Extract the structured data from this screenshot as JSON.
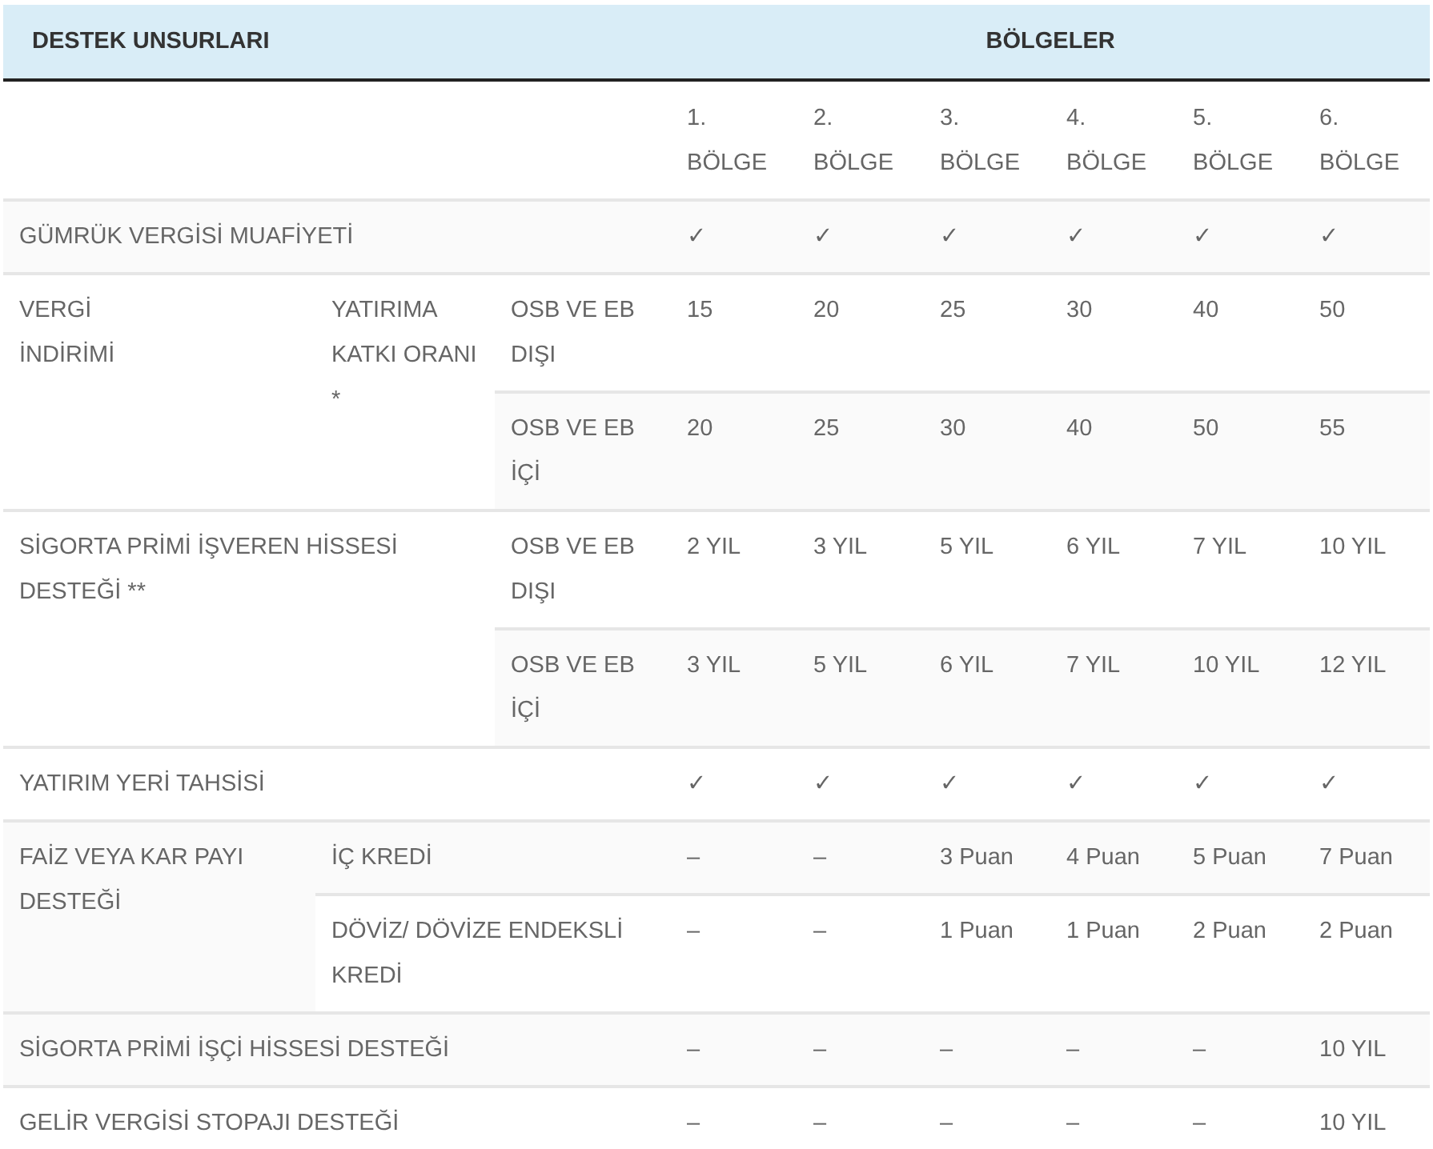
{
  "header": {
    "label": "DESTEK UNSURLARI",
    "regions_label": "BÖLGELER"
  },
  "regions": [
    "1. BÖLGE",
    "2. BÖLGE",
    "3. BÖLGE",
    "4. BÖLGE",
    "5. BÖLGE",
    "6. BÖLGE"
  ],
  "rows": [
    {
      "kind": "single",
      "label": "GÜMRÜK VERGİSİ MUAFİYETİ",
      "values": [
        "✓",
        "✓",
        "✓",
        "✓",
        "✓",
        "✓"
      ]
    },
    {
      "kind": "nested",
      "label": "VERGİ İNDİRİMİ",
      "children": [
        {
          "label": "YATIRIMA KATKI ORANI *",
          "children": [
            {
              "label": "OSB VE EB DIŞI",
              "values": [
                "15",
                "20",
                "25",
                "30",
                "40",
                "50"
              ]
            },
            {
              "label": "OSB VE EB İÇİ",
              "values": [
                "20",
                "25",
                "30",
                "40",
                "50",
                "55"
              ]
            }
          ]
        }
      ]
    },
    {
      "kind": "wide_group",
      "label": "SİGORTA PRİMİ İŞVEREN HİSSESİ DESTEĞİ **",
      "children": [
        {
          "label": "OSB VE EB DIŞI",
          "values": [
            "2 YIL",
            "3 YIL",
            "5 YIL",
            "6 YIL",
            "7 YIL",
            "10 YIL"
          ]
        },
        {
          "label": "OSB VE EB İÇİ",
          "values": [
            "3 YIL",
            "5 YIL",
            "6 YIL",
            "7 YIL",
            "10 YIL",
            "12 YIL"
          ]
        }
      ]
    },
    {
      "kind": "single",
      "label": "YATIRIM YERİ TAHSİSİ",
      "values": [
        "✓",
        "✓",
        "✓",
        "✓",
        "✓",
        "✓"
      ]
    },
    {
      "kind": "group",
      "label": "FAİZ VEYA KAR PAYI DESTEĞİ",
      "children": [
        {
          "label": "İÇ KREDİ",
          "values": [
            "–",
            "–",
            "3 Puan",
            "4 Puan",
            "5 Puan",
            "7 Puan"
          ]
        },
        {
          "label": "DÖVİZ/ DÖVİZE ENDEKSLİ KREDİ",
          "values": [
            "–",
            "–",
            "1 Puan",
            "1 Puan",
            "2 Puan",
            "2 Puan"
          ]
        }
      ]
    },
    {
      "kind": "single",
      "label": "SİGORTA PRİMİ İŞÇİ HİSSESİ DESTEĞİ",
      "values": [
        "–",
        "–",
        "–",
        "–",
        "–",
        "10 YIL"
      ]
    },
    {
      "kind": "single",
      "label": "GELİR VERGİSİ STOPAJI DESTEĞİ",
      "values": [
        "–",
        "–",
        "–",
        "–",
        "–",
        "10 YIL"
      ]
    }
  ]
}
